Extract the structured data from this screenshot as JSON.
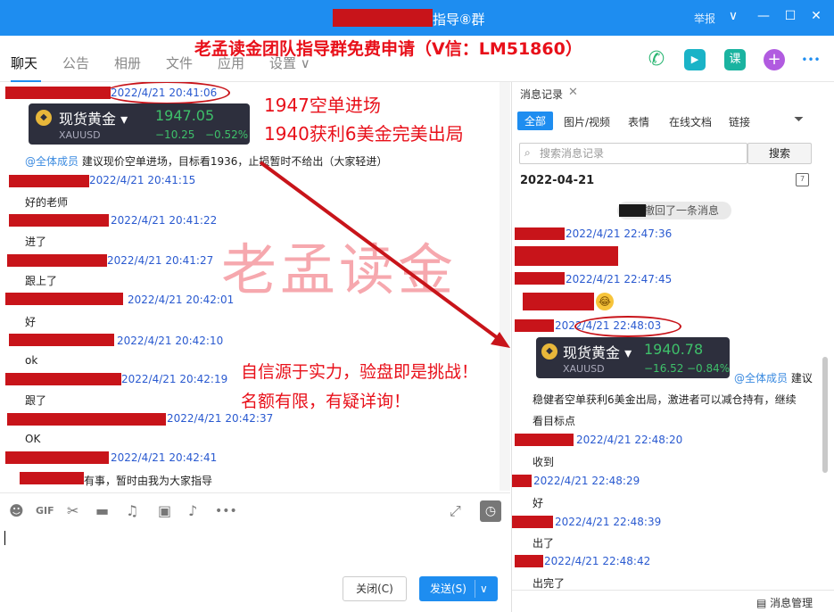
{
  "window": {
    "title": "指导⑧群",
    "report_label": "举报",
    "controls": {
      "dropdown": "∨",
      "minimize": "—",
      "maximize": "☐",
      "close": "✕"
    }
  },
  "nav": {
    "tabs": [
      "聊天",
      "公告",
      "相册",
      "文件",
      "应用",
      "设置 ∨"
    ],
    "promo": "老孟读金团队指导群免费申请（V信：LM51860）",
    "icons": {
      "call": "✆",
      "video": "▶",
      "course": "课",
      "add": "+",
      "more": "•••"
    }
  },
  "chat": {
    "messages": [
      {
        "time": "2022/4/21 20:41:06"
      },
      {
        "mention": "@全体成员",
        "text": "建议现价空单进场，目标看1936，止损暂时不给出（大家轻进）"
      },
      {
        "time": "2022/4/21 20:41:15",
        "text": "好的老师"
      },
      {
        "time": "2022/4/21 20:41:22",
        "text": "进了"
      },
      {
        "time": "2022/4/21 20:41:27",
        "text": "跟上了"
      },
      {
        "time": "2022/4/21 20:42:01",
        "text": "好"
      },
      {
        "time": "2022/4/21 20:42:10",
        "text": "ok"
      },
      {
        "time": "2022/4/21 20:42:19",
        "text": "跟了"
      },
      {
        "time": "2022/4/21 20:42:37",
        "text": "OK"
      },
      {
        "time": "2022/4/21 20:42:41",
        "text": "有事，暂时由我为大家指导"
      }
    ],
    "quote": {
      "name": "现货黄金 ▾",
      "code": "XAUUSD",
      "price": "1947.05",
      "change": "−10.25",
      "change_pct": "−0.52%"
    },
    "annotations": {
      "entry": "1947空单进场",
      "profit": "1940获利6美金完美出局",
      "slogan1": "自信源于实力，验盘即是挑战！",
      "slogan2": "名额有限，有疑详询！"
    },
    "watermark": "老孟读金"
  },
  "input": {
    "close_label": "关闭(C)",
    "send_label": "发送(S)",
    "send_arrow": "∨"
  },
  "history": {
    "title": "消息记录",
    "tabs": [
      "全部",
      "图片/视频",
      "表情",
      "在线文档",
      "链接"
    ],
    "search_placeholder": "搜索消息记录",
    "search_button": "搜索",
    "date": "2022-04-21",
    "recall_text": "撤回了一条消息",
    "messages": [
      {
        "time": "2022/4/21 22:47:36"
      },
      {
        "time": "2022/4/21 22:47:45"
      },
      {
        "time": "2022/4/21 22:48:03"
      },
      {
        "mention": "@全体成员",
        "text1": "建议",
        "text2": "稳健者空单获利6美金出局，激进者可以减仓持有，继续",
        "text3": "看目标点"
      },
      {
        "time": "2022/4/21 22:48:20",
        "text": "收到"
      },
      {
        "time": "2022/4/21 22:48:29",
        "text": "好"
      },
      {
        "time": "2022/4/21 22:48:39",
        "text": "出了"
      },
      {
        "time": "2022/4/21 22:48:42",
        "text": "出完了"
      }
    ],
    "quote": {
      "name": "现货黄金 ▾",
      "code": "XAUUSD",
      "price": "1940.78",
      "change": "−16.52",
      "change_pct": "−0.84%"
    },
    "manage_label": "消息管理"
  },
  "colors": {
    "accent": "#1e8df0",
    "redaction": "#c8141a",
    "annotation": "#e8101a",
    "up_green": "#3ec06a"
  }
}
